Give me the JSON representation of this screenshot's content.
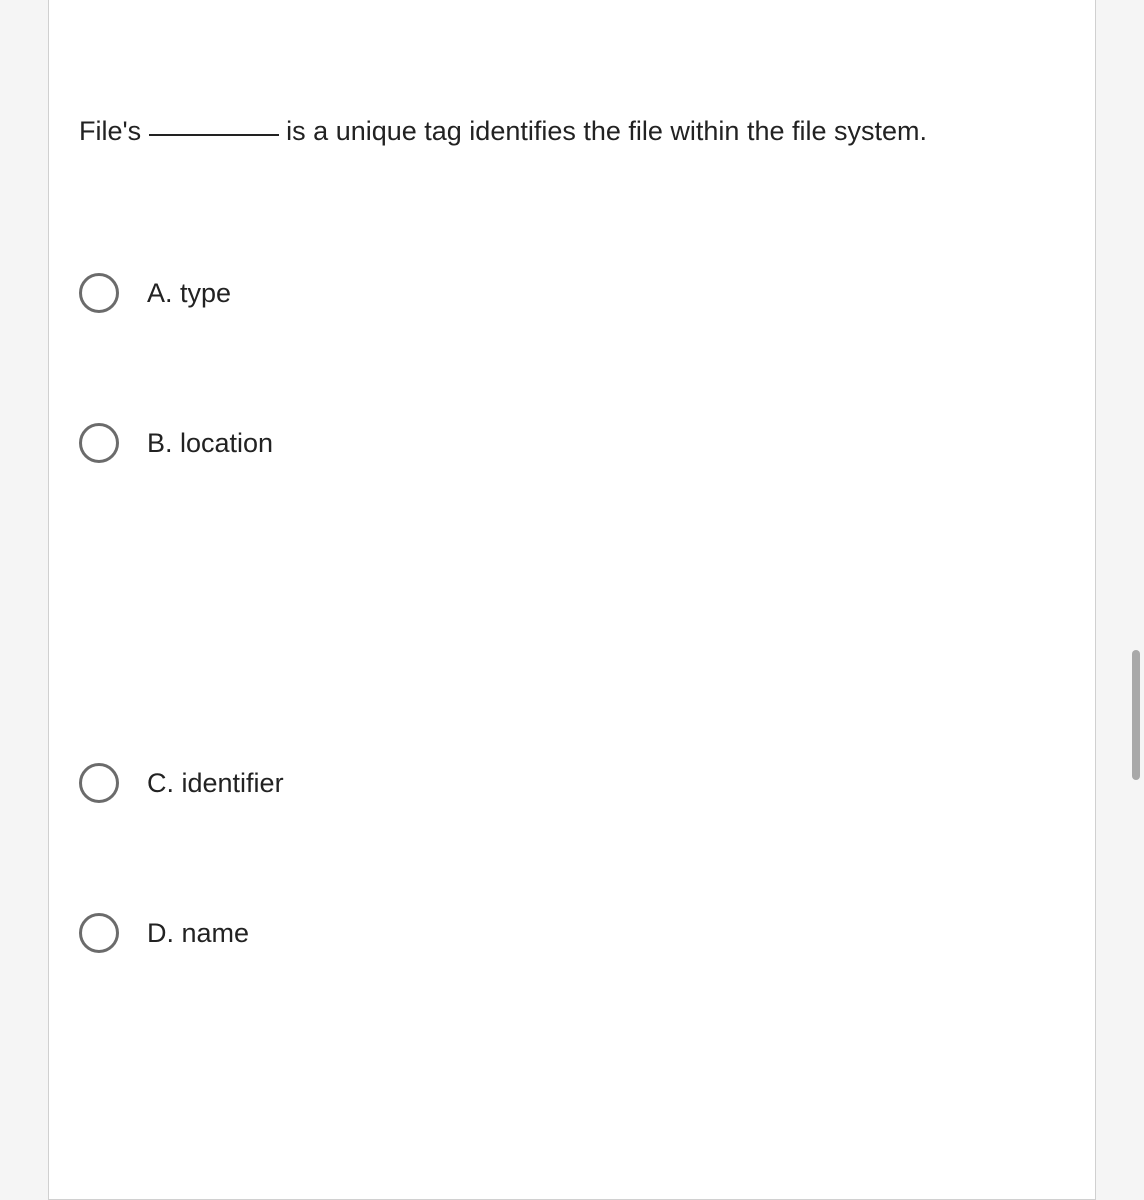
{
  "question": {
    "prefix": "File's ",
    "suffix": " is a unique tag identifies the file within the file system."
  },
  "options": {
    "a": "A. type",
    "b": "B. location",
    "c": "C. identifier",
    "d": "D. name"
  }
}
